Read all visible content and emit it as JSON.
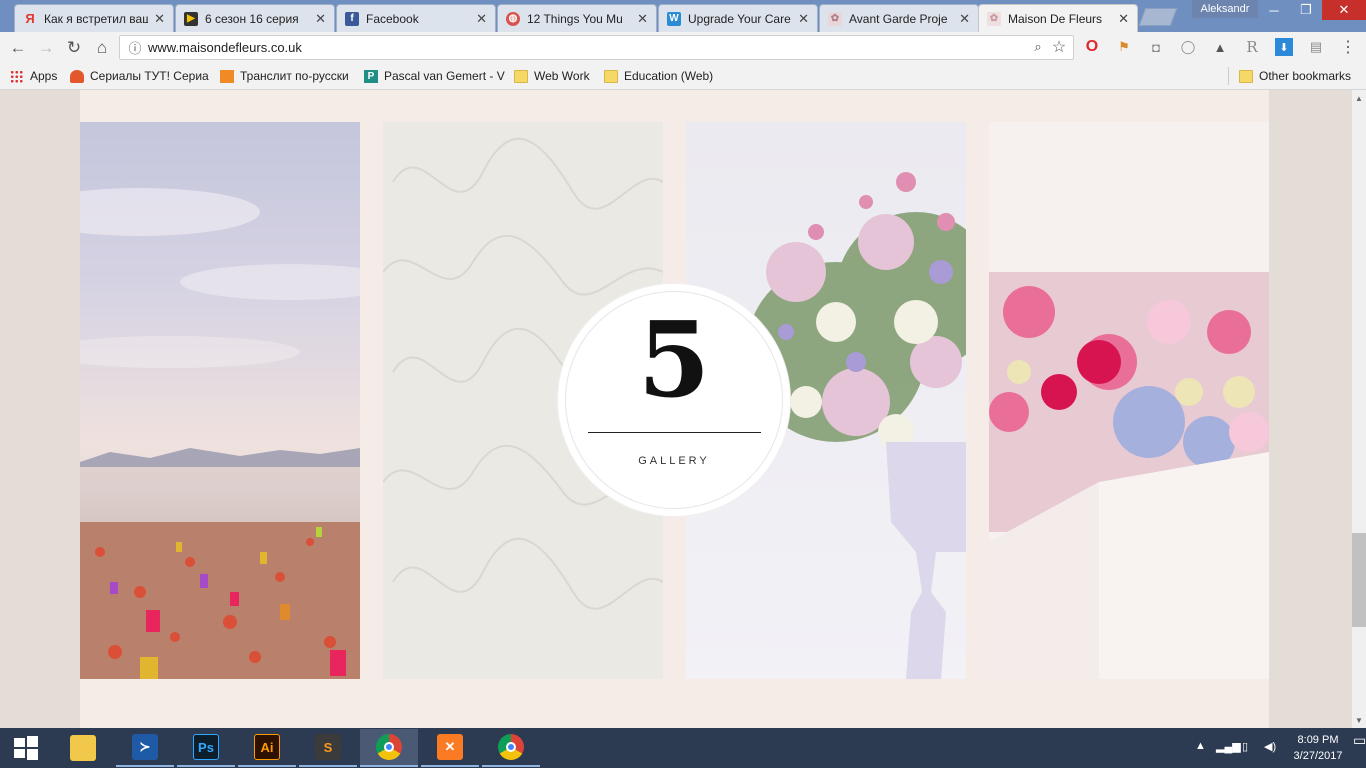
{
  "browser": {
    "tabs": [
      {
        "title": "Как я встретил вашу",
        "icon": "yandex-icon",
        "color": "#e4372e",
        "active": false
      },
      {
        "title": "6 сезон 16 серия",
        "icon": "play-icon",
        "color": "#444444",
        "active": false
      },
      {
        "title": "Facebook",
        "icon": "facebook-icon",
        "color": "#3b5998",
        "active": false
      },
      {
        "title": "12 Things You Mu",
        "icon": "avatar-icon",
        "color": "#d9534f",
        "active": false
      },
      {
        "title": "Upgrade Your Care",
        "icon": "w-icon",
        "color": "#2a8dd4",
        "active": false
      },
      {
        "title": "Avant Garde Proje",
        "icon": "flower-icon",
        "color": "#c9b3b8",
        "active": false
      },
      {
        "title": "Maison De Fleurs",
        "icon": "flower-icon",
        "color": "#e7c9cc",
        "active": true
      }
    ],
    "user": "Aleksandr",
    "url": "www.maisondefleurs.co.uk",
    "bookmarks": [
      {
        "label": "Apps",
        "type": "apps"
      },
      {
        "label": "Сериалы ТУТ! Сериа",
        "type": "site"
      },
      {
        "label": "Транслит по-русски",
        "type": "site"
      },
      {
        "label": "Pascal van Gemert - V",
        "type": "site"
      },
      {
        "label": "Web Work",
        "type": "folder"
      },
      {
        "label": "Education (Web)",
        "type": "folder"
      }
    ],
    "other_bookmarks": "Other bookmarks"
  },
  "gallery": {
    "number": "5",
    "label": "GALLERY",
    "panels": [
      "beach-candles-photo",
      "calligraphy-paper-photo",
      "flower-urn-photo",
      "flower-bouquet-photo"
    ]
  },
  "taskbar": {
    "apps": [
      "start",
      "file-explorer",
      "powershell",
      "photoshop",
      "illustrator",
      "sublime-text",
      "chrome",
      "xampp",
      "chrome"
    ],
    "labels": {
      "photoshop": "Ps",
      "illustrator": "Ai",
      "sublime": "S"
    },
    "time": "8:09 PM",
    "date": "3/27/2017"
  }
}
